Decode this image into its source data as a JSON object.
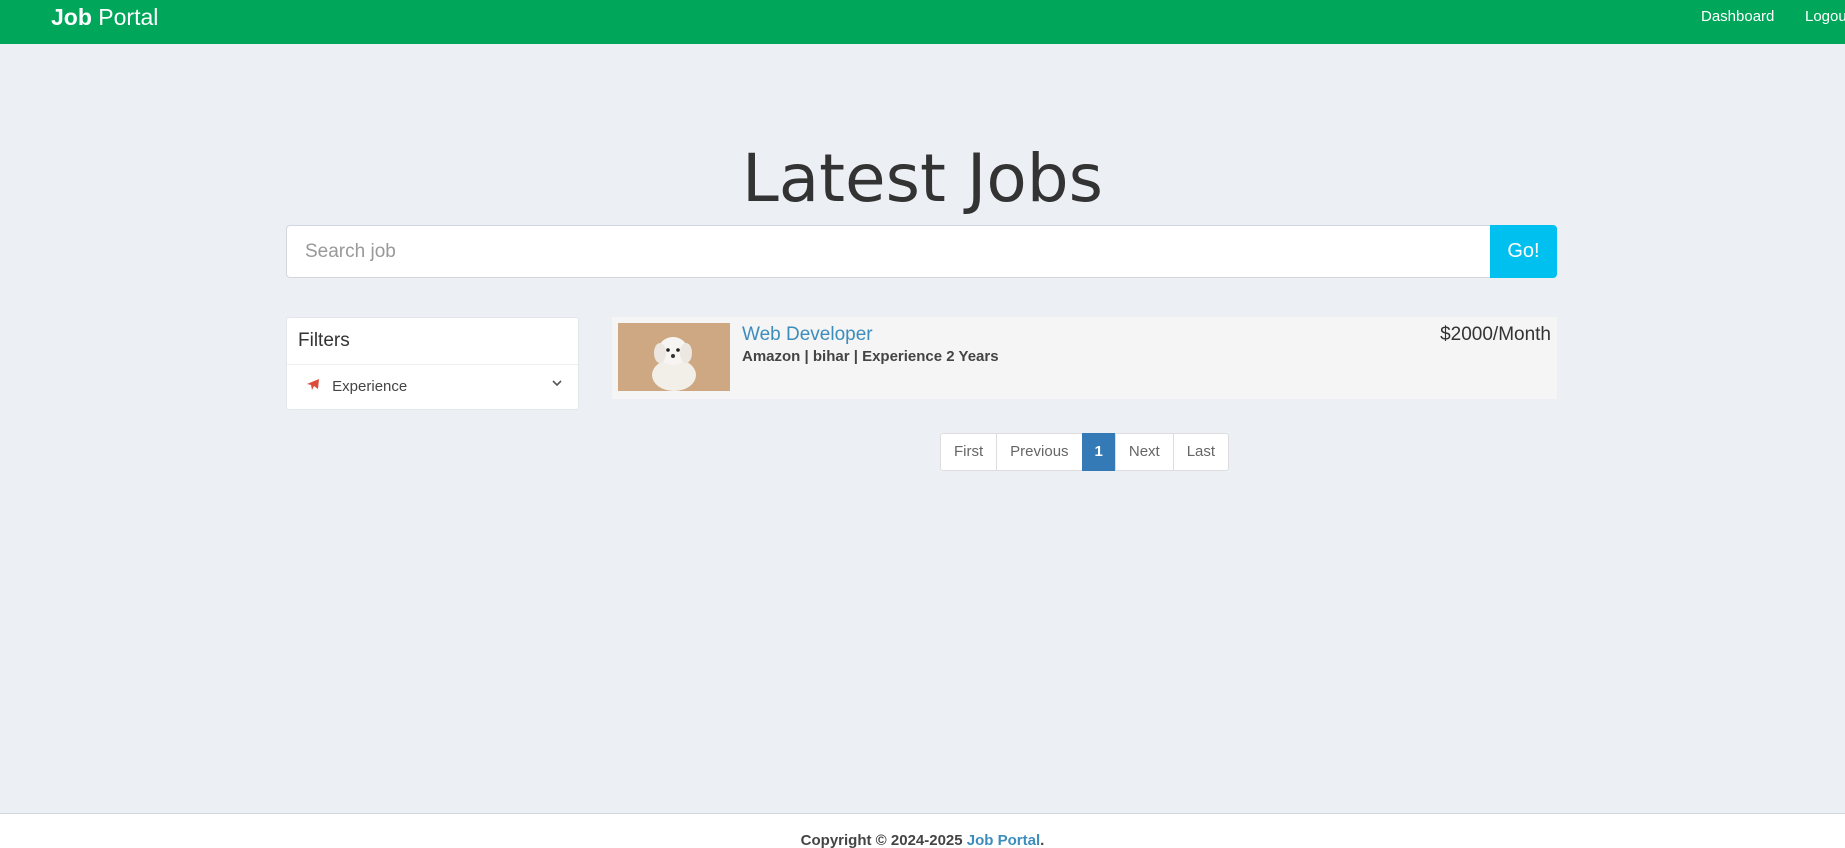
{
  "navbar": {
    "brand_bold": "Job",
    "brand_rest": "Portal",
    "links": [
      {
        "label": "Dashboard"
      },
      {
        "label": "Logou"
      }
    ]
  },
  "hero": {
    "title": "Latest Jobs"
  },
  "search": {
    "placeholder": "Search job",
    "value": "",
    "button_label": "Go!"
  },
  "filters": {
    "header": "Filters",
    "items": [
      {
        "label": "Experience",
        "icon": "plane-icon",
        "chevron": "chevron-down-icon"
      }
    ]
  },
  "jobs": [
    {
      "title": "Web Developer",
      "meta": "Amazon | bihar | Experience 2 Years",
      "salary": "$2000/Month",
      "thumbnail": "dog-photo"
    }
  ],
  "pagination": {
    "items": [
      {
        "label": "First",
        "active": false
      },
      {
        "label": "Previous",
        "active": false
      },
      {
        "label": "1",
        "active": true
      },
      {
        "label": "Next",
        "active": false
      },
      {
        "label": "Last",
        "active": false
      }
    ]
  },
  "footer": {
    "prefix": "Copyright © 2024-2025",
    "link": "Job Portal",
    "suffix": "."
  },
  "colors": {
    "navbar": "#00a65a",
    "go_button": "#00c0ef",
    "link": "#3c8dbc",
    "active_page": "#337ab7",
    "plane_icon": "#dd4b39",
    "background": "#ecf0f5"
  }
}
